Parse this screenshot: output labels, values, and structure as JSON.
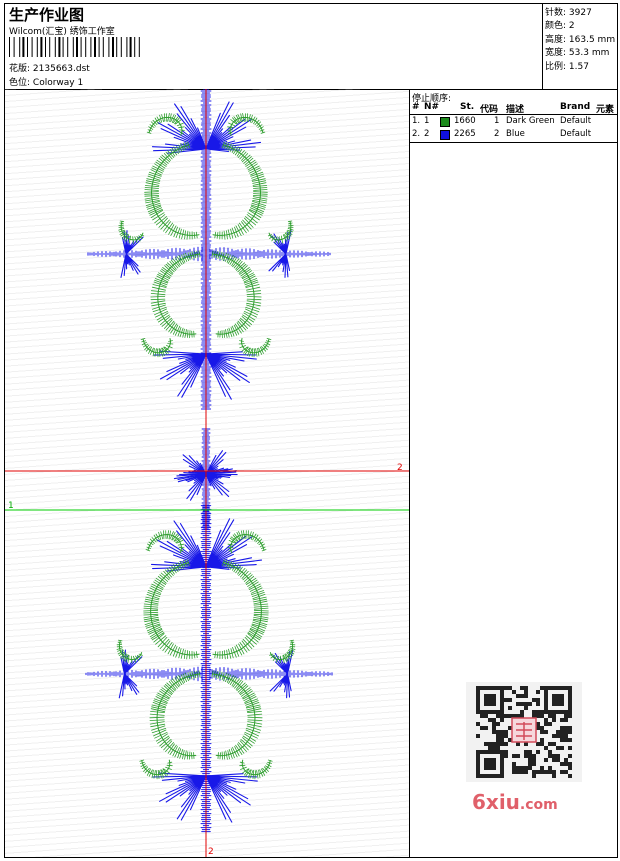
{
  "header": {
    "title": "生产作业图",
    "company": "Wilcom(汇宝) 绣饰工作室",
    "design_label": "花版:",
    "design_file": "2135663.dst",
    "colorway_label": "色位:",
    "colorway": "Colorway 1"
  },
  "stats": {
    "stitches_label": "针数:",
    "stitches": "3927",
    "colors_label": "颜色:",
    "colors": "2",
    "height_label": "高度:",
    "height": "163.5 mm",
    "width_label": "宽度:",
    "width": "53.3 mm",
    "ratio_label": "比例:",
    "ratio": "1.57"
  },
  "stop_panel": {
    "title": "停止顺序:",
    "columns": [
      "#",
      "N#",
      "St.",
      "代码",
      "描述",
      "Brand",
      "元素"
    ],
    "rows": [
      {
        "index": "1.",
        "n": "1",
        "stitches": "1660",
        "code": "1",
        "description": "Dark Green",
        "brand": "Default",
        "color": "#1c8a1c"
      },
      {
        "index": "2.",
        "n": "2",
        "stitches": "2265",
        "code": "2",
        "description": "Blue",
        "brand": "Default",
        "color": "#1010e0"
      }
    ]
  },
  "canvas": {
    "guide_red_label": "2",
    "guide_green_label": "1",
    "guide_vertical_label": "2",
    "colors": {
      "green": "#2e9e2e",
      "blue": "#1818e8",
      "red": "#e00000",
      "guide_green": "#00cc00"
    }
  },
  "watermark": {
    "text_main": "6xiu",
    "text_tail": ".com",
    "color": "#e0606a"
  }
}
